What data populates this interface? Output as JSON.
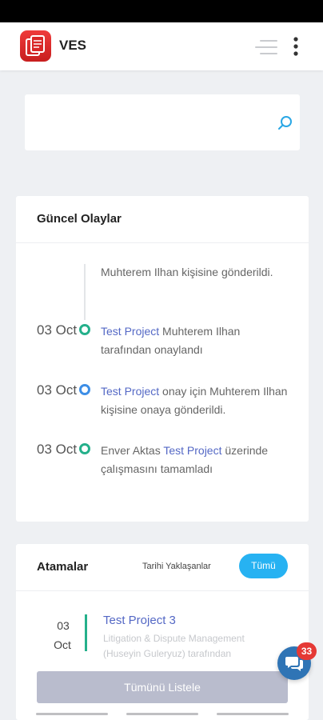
{
  "header": {
    "title": "VES",
    "logo_icon": "document-stack-icon",
    "menu_icon": "menu-lines-icon",
    "more_icon": "kebab-icon"
  },
  "search": {
    "placeholder": "",
    "icon": "search-icon"
  },
  "events": {
    "title": "Güncel Olaylar",
    "items": [
      {
        "date": "",
        "dot_color": "",
        "parts": [
          "Muhterem Ilhan kişisine gönderildi."
        ]
      },
      {
        "date": "03 Oct",
        "dot_color": "#25b08b",
        "link": "Test Project",
        "text": " Muhterem Ilhan tarafından onaylandı"
      },
      {
        "date": "03 Oct",
        "dot_color": "#3d8ee6",
        "link": "Test Project",
        "text": " onay için Muhterem Ilhan kişisine onaya gönderildi."
      },
      {
        "date": "03 Oct",
        "dot_color": "#25b08b",
        "prefix": "Enver Aktas ",
        "link": "Test Project",
        "text": " üzerinde çalışmasını tamamladı"
      }
    ]
  },
  "assignments": {
    "title": "Atamalar",
    "tab_upcoming": "Tarihi Yaklaşanlar",
    "tab_all": "Tümü",
    "item": {
      "day": "03",
      "month": "Oct",
      "title": "Test Project 3",
      "description": "Litigation & Dispute Management (Huseyin Guleryuz) tarafından"
    },
    "list_button": "Tümünü Listele"
  },
  "chat": {
    "badge": "33",
    "icon": "chat-bubbles-icon"
  },
  "colors": {
    "accent": "#27b2f2",
    "link": "#5468c5",
    "success": "#25b08b",
    "brand": "#e02d2d"
  }
}
